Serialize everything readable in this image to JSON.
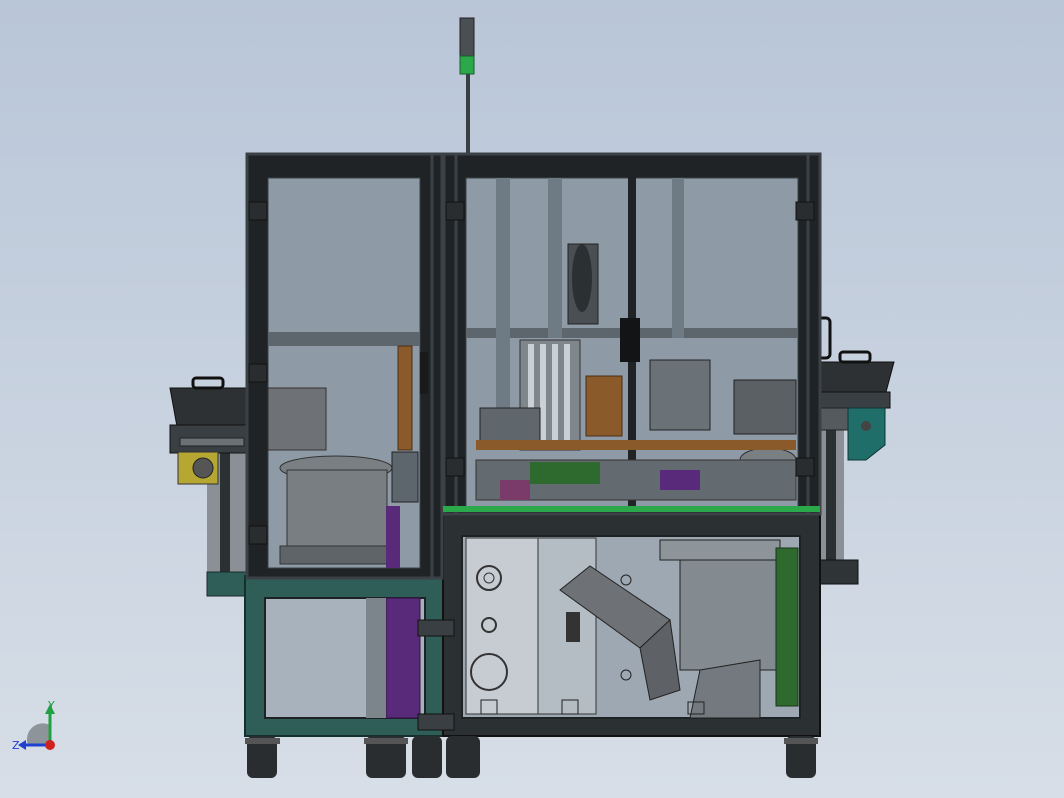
{
  "view": {
    "type": "CAD isometric/front view of automated assembly machine",
    "style": "shaded-with-edges",
    "background_gradient": [
      "#b9c6d8",
      "#d7dee7"
    ]
  },
  "colors": {
    "frame": "#1f2326",
    "frame_edge": "#3b4146",
    "glass": "#8e9aa6",
    "base_teal": "#2f5d58",
    "base_dark": "#2b3032",
    "purple_panel": "#5a2a7a",
    "green_panel": "#2e6a2e",
    "brown_post": "#8a5a2a",
    "tower_green": "#2aa84a",
    "hopper_teal": "#1f6e6a",
    "feeder_grey": "#6e7276",
    "wheel": "#2a2d2f"
  },
  "axis_triad": {
    "x_label": "",
    "y_label": "Y",
    "z_label": "Z",
    "x_color": "#d02020",
    "y_color": "#20a040",
    "z_color": "#2040d0"
  }
}
